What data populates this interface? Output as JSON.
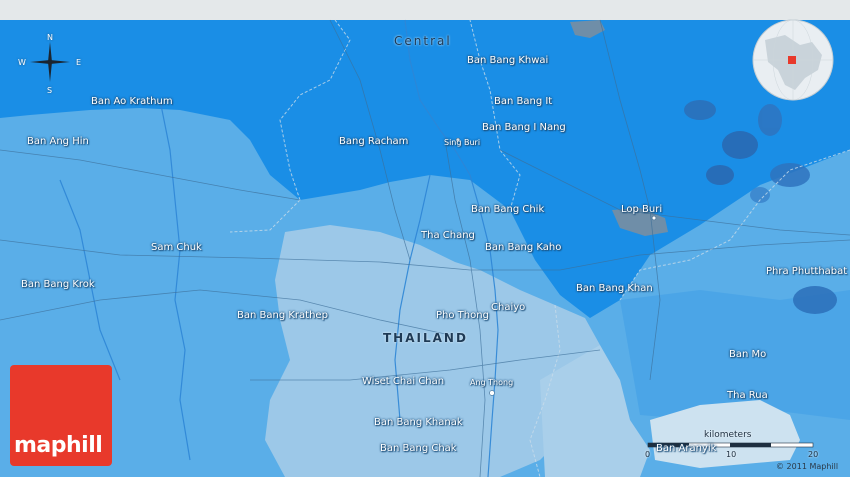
{
  "region_label": "Central",
  "country_label": "THAILAND",
  "compass": {
    "n": "N",
    "s": "S",
    "e": "E",
    "w": "W"
  },
  "places": [
    {
      "id": "ban-bang-khwai",
      "name": "Ban Bang Khwai"
    },
    {
      "id": "ban-bang-it",
      "name": "Ban Bang It"
    },
    {
      "id": "ban-ao-krathum",
      "name": "Ban Ao Krathum"
    },
    {
      "id": "ban-bang-i-nang",
      "name": "Ban Bang I Nang"
    },
    {
      "id": "ban-ang-hin",
      "name": "Ban Ang Hin"
    },
    {
      "id": "bang-racham",
      "name": "Bang Racham"
    },
    {
      "id": "sing-buri",
      "name": "Sing Buri"
    },
    {
      "id": "ban-bang-chik",
      "name": "Ban Bang Chik"
    },
    {
      "id": "lop-buri",
      "name": "Lop Buri"
    },
    {
      "id": "tha-chang",
      "name": "Tha Chang"
    },
    {
      "id": "sam-chuk",
      "name": "Sam Chuk"
    },
    {
      "id": "ban-bang-kaho",
      "name": "Ban Bang Kaho"
    },
    {
      "id": "phra-phutthabat",
      "name": "Phra Phutthabat"
    },
    {
      "id": "ban-bang-krok",
      "name": "Ban Bang Krok"
    },
    {
      "id": "ban-bang-khan",
      "name": "Ban Bang Khan"
    },
    {
      "id": "chaiyo",
      "name": "Chaiyo"
    },
    {
      "id": "ban-bang-krathep",
      "name": "Ban Bang Krathep"
    },
    {
      "id": "pho-thong",
      "name": "Pho Thong"
    },
    {
      "id": "ban-mo",
      "name": "Ban Mo"
    },
    {
      "id": "wiset-chai-chan",
      "name": "Wiset Chai Chan"
    },
    {
      "id": "ang-thong",
      "name": "Ang Thong"
    },
    {
      "id": "tha-rua",
      "name": "Tha Rua"
    },
    {
      "id": "ban-bang-khanak",
      "name": "Ban Bang Khanak"
    },
    {
      "id": "ban-aranyik",
      "name": "Ban Aranyik"
    },
    {
      "id": "ban-bang-chak",
      "name": "Ban Bang Chak"
    }
  ],
  "scale": {
    "unit": "kilometers",
    "ticks": [
      "0",
      "10",
      "20"
    ]
  },
  "logo_text": "maphill",
  "copyright": "© 2011 Maphill",
  "colors": {
    "deep_region": "#1a8ee6",
    "lowland": "#5aaee8",
    "pale_plain": "#9cc8e8",
    "logo_red": "#e8392b"
  }
}
